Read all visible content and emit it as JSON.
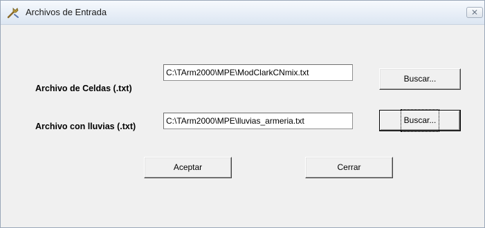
{
  "window": {
    "title": "Archivos de Entrada",
    "close_glyph": "✕",
    "icon": "tools-icon"
  },
  "form": {
    "celdas_label": "Archivo de Celdas (.txt)",
    "celdas_value": "C:\\TArm2000\\MPE\\ModClarkCNmix.txt",
    "lluvias_label": "Archivo con lluvias (.txt)",
    "lluvias_value": "C:\\TArm2000\\MPE\\lluvias_armeria.txt",
    "buscar_label": "Buscar..."
  },
  "actions": {
    "aceptar_label": "Aceptar",
    "cerrar_label": "Cerrar"
  }
}
